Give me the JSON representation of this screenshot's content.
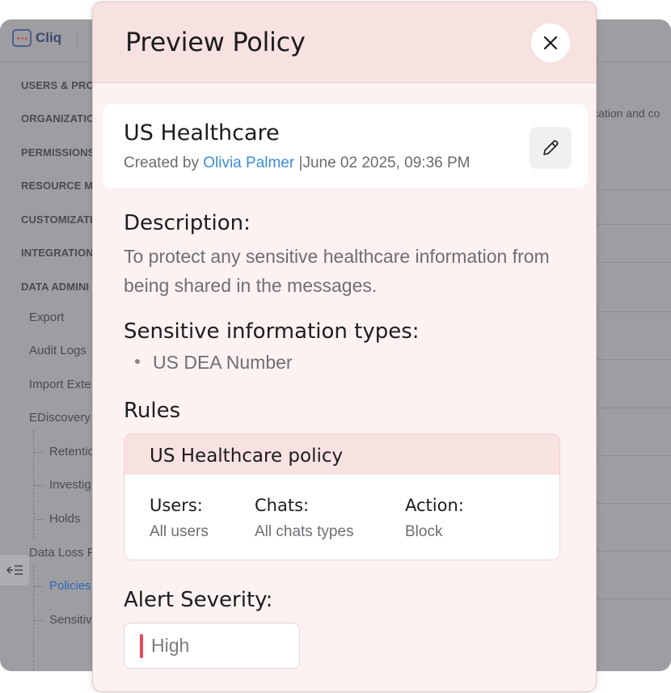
{
  "app": {
    "name": "Cliq",
    "nav": {
      "sections": [
        "USERS & PROF",
        "ORGANIZATIO",
        "PERMISSIONS",
        "RESOURCE MA",
        "CUSTOMIZATI",
        "INTEGRATION",
        "DATA ADMINI"
      ],
      "items": [
        "Export",
        "Audit Logs",
        "Import Exte",
        "EDiscovery"
      ],
      "ediscovery_children": [
        "Retentio",
        "Investig",
        "Holds"
      ],
      "dlp_label": "Data Loss P",
      "dlp_children": [
        "Policies",
        "Sensitiv"
      ]
    },
    "right_fragment": "ication and co",
    "collapse_icon": "sidebar-collapse-icon"
  },
  "modal": {
    "title": "Preview Policy",
    "close_icon": "close-icon",
    "policy": {
      "name": "US Healthcare",
      "created_prefix": "Created by",
      "author": "Olivia Palmer",
      "separator": "|",
      "created_at": "June 02 2025, 09:36 PM",
      "edit_icon": "pencil-icon"
    },
    "description_heading": "Description:",
    "description_text": "To protect any sensitive healthcare information from being shared in the messages.",
    "sensitive_heading": "Sensitive information types:",
    "sensitive_types": [
      "US DEA Number"
    ],
    "rules_heading": "Rules",
    "rule": {
      "title": "US Healthcare policy",
      "users_label": "Users:",
      "users_value": "All users",
      "chats_label": "Chats:",
      "chats_value": "All chats types",
      "action_label": "Action:",
      "action_value": "Block"
    },
    "severity_heading": "Alert Severity:",
    "severity_value": "High",
    "severity_color": "#e94a5f"
  }
}
